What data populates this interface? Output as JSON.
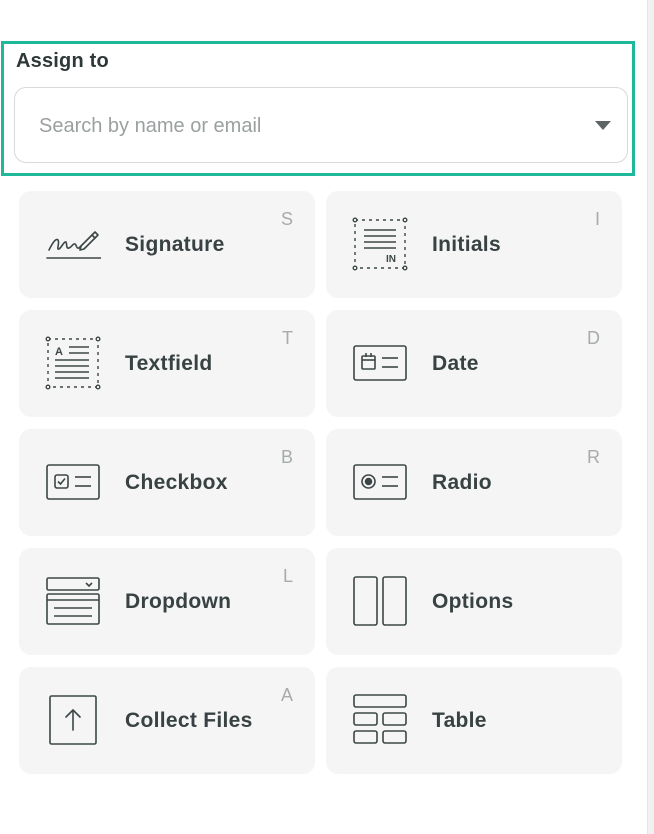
{
  "assign": {
    "label": "Assign to",
    "search_placeholder": "Search by name or email"
  },
  "fields": [
    {
      "label": "Signature",
      "shortcut": "S",
      "icon": "signature-icon"
    },
    {
      "label": "Initials",
      "shortcut": "I",
      "icon": "initials-icon"
    },
    {
      "label": "Textfield",
      "shortcut": "T",
      "icon": "textfield-icon"
    },
    {
      "label": "Date",
      "shortcut": "D",
      "icon": "date-icon"
    },
    {
      "label": "Checkbox",
      "shortcut": "B",
      "icon": "checkbox-icon"
    },
    {
      "label": "Radio",
      "shortcut": "R",
      "icon": "radio-icon"
    },
    {
      "label": "Dropdown",
      "shortcut": "L",
      "icon": "dropdown-icon"
    },
    {
      "label": "Options",
      "shortcut": "",
      "icon": "options-icon"
    },
    {
      "label": "Collect Files",
      "shortcut": "A",
      "icon": "upload-icon"
    },
    {
      "label": "Table",
      "shortcut": "",
      "icon": "table-icon"
    }
  ],
  "colors": {
    "accent_border": "#1fb89a",
    "tile_bg": "#f5f5f5",
    "text": "#384242",
    "shortcut_text": "#a6abab"
  }
}
